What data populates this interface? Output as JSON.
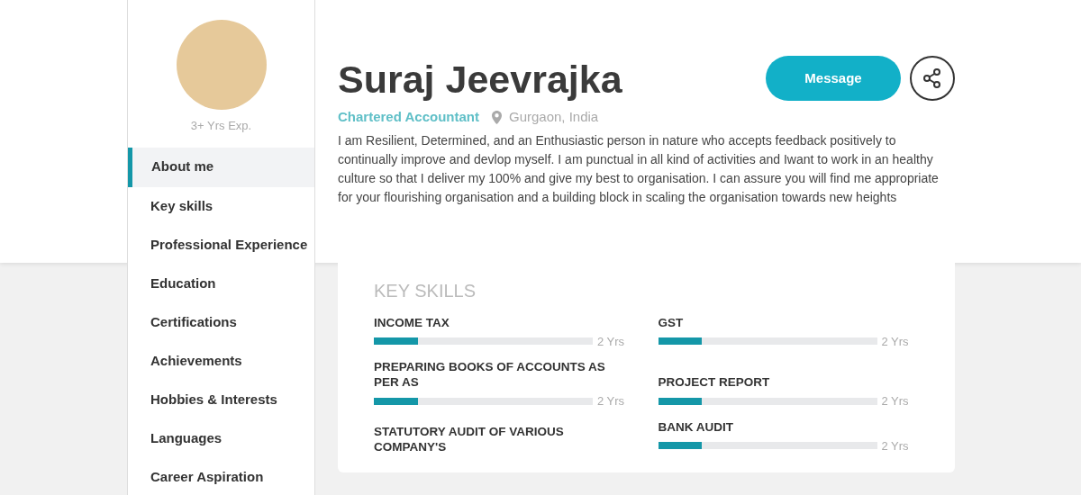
{
  "profile": {
    "experience": "3+ Yrs Exp.",
    "name": "Suraj Jeevrajka",
    "title": "Chartered Accountant",
    "location": "Gurgaon, India",
    "bio": "I am Resilient, Determined, and an Enthusiastic person in nature who accepts feedback positively to continually improve and devlop myself. I am punctual in all kind of activities and Iwant to work in an healthy culture so that I deliver my 100% and give my best to organisation. I can assure you will find me appropriate for your flourishing organisation and a building block in scaling the organisation towards new heights"
  },
  "actions": {
    "message": "Message"
  },
  "sidebar": {
    "items": [
      {
        "label": "About me",
        "selected": true
      },
      {
        "label": "Key skills",
        "selected": false
      },
      {
        "label": "Professional Experience",
        "selected": false
      },
      {
        "label": "Education",
        "selected": false
      },
      {
        "label": "Certifications",
        "selected": false
      },
      {
        "label": "Achievements",
        "selected": false
      },
      {
        "label": "Hobbies & Interests",
        "selected": false
      },
      {
        "label": "Languages",
        "selected": false
      },
      {
        "label": "Career Aspiration",
        "selected": false
      }
    ]
  },
  "key_skills": {
    "heading": "KEY SKILLS",
    "skills": [
      {
        "name": "INCOME TAX",
        "level": 0.2,
        "years": "2 Yrs"
      },
      {
        "name": "GST",
        "level": 0.2,
        "years": "2 Yrs"
      },
      {
        "name": "PREPARING BOOKS OF ACCOUNTS AS PER AS",
        "level": 0.2,
        "years": "2 Yrs"
      },
      {
        "name": "PROJECT REPORT",
        "level": 0.2,
        "years": "2 Yrs"
      },
      {
        "name": "STATUTORY AUDIT OF VARIOUS COMPANY'S"
      },
      {
        "name": "BANK AUDIT",
        "level": 0.2,
        "years": "2 Yrs"
      }
    ]
  }
}
